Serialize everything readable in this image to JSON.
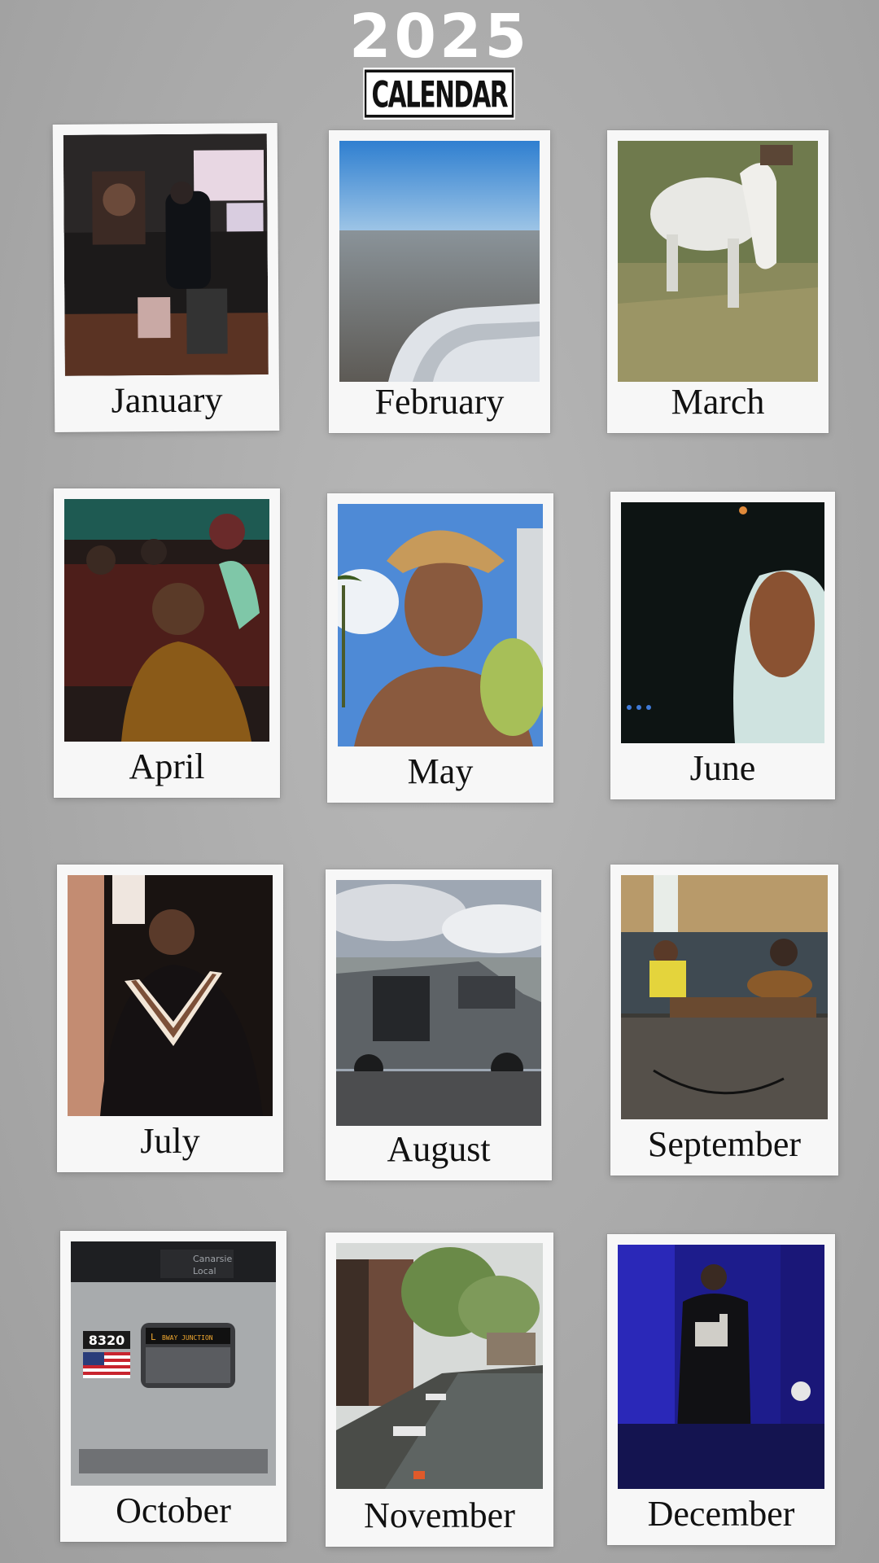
{
  "header": {
    "year": "2025",
    "subtitle": "CALENDAR"
  },
  "months": [
    {
      "label": "January",
      "photo_icon": "studio-photo"
    },
    {
      "label": "February",
      "photo_icon": "airplane-window-photo"
    },
    {
      "label": "March",
      "photo_icon": "white-horse-photo"
    },
    {
      "label": "April",
      "photo_icon": "group-of-people-photo"
    },
    {
      "label": "May",
      "photo_icon": "selfie-with-coconut-photo"
    },
    {
      "label": "June",
      "photo_icon": "dark-night-photo"
    },
    {
      "label": "July",
      "photo_icon": "man-in-sweater-photo"
    },
    {
      "label": "August",
      "photo_icon": "van-photo"
    },
    {
      "label": "September",
      "photo_icon": "music-session-photo"
    },
    {
      "label": "October",
      "photo_icon": "subway-train-photo"
    },
    {
      "label": "November",
      "photo_icon": "canal-photo"
    },
    {
      "label": "December",
      "photo_icon": "concert-stage-photo"
    }
  ],
  "train": {
    "car_number": "8320",
    "line_sign": "L",
    "destination_sign": "BWAY JUNCTION",
    "route_sign": "Canarsie Local"
  }
}
